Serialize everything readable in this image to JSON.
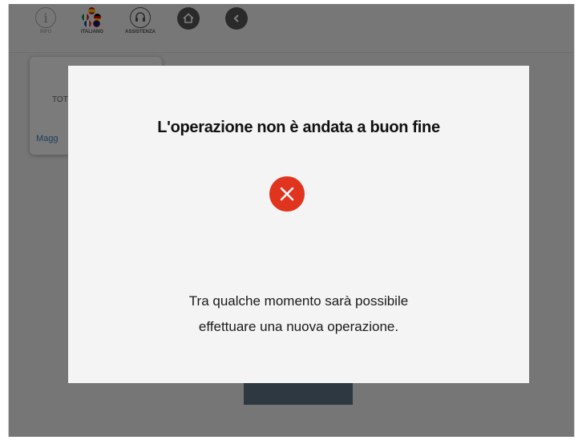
{
  "topbar": {
    "info_label": "INFO",
    "info_glyph": "i",
    "language_label": "ITALIANO",
    "support_label": "ASSISTENZA",
    "icons": [
      "info-icon",
      "language-flags-icon",
      "headset-icon",
      "home-icon",
      "back-arrow-icon"
    ]
  },
  "popup": {
    "tot_text": "TOT",
    "more_text": "Magg"
  },
  "modal": {
    "title": "L'operazione non è andata a buon fine",
    "status_icon": "error-x-icon",
    "status_color": "#e1341e",
    "message_line1": "Tra qualche momento sarà possibile",
    "message_line2": "effettuare una nuova operazione."
  }
}
